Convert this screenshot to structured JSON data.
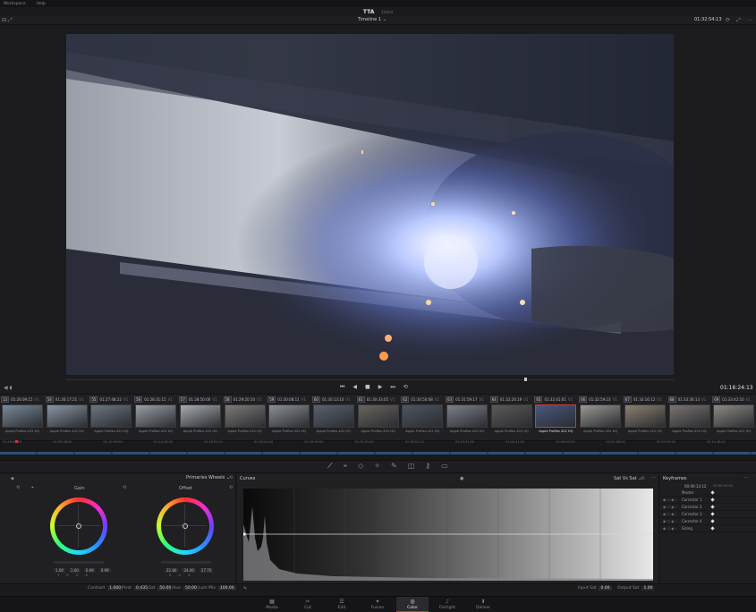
{
  "menu": {
    "items": [
      "Workspace",
      "Help"
    ]
  },
  "app": {
    "title": "TTA",
    "subtitle": "Edited"
  },
  "viewer": {
    "timeline_name": "Timeline 1",
    "timecode": "01:32:54:13"
  },
  "transport": {
    "timecode": "01:16:24:13"
  },
  "clips": [
    {
      "num": "13",
      "tc": "01:26:09:15",
      "track": "V1",
      "codec": "Apple ProRes 422 HQ",
      "color": "#7a8a98"
    },
    {
      "num": "54",
      "tc": "01:26:17:21",
      "track": "V1",
      "codec": "Apple ProRes 422 HQ",
      "color": "#8a96a4"
    },
    {
      "num": "55",
      "tc": "01:27:48:22",
      "track": "V1",
      "codec": "Apple ProRes 422 HQ",
      "color": "#6c7680"
    },
    {
      "num": "56",
      "tc": "01:28:31:15",
      "track": "V1",
      "codec": "Apple ProRes 422 HQ",
      "color": "#9aa0a6"
    },
    {
      "num": "57",
      "tc": "01:28:50:00",
      "track": "V1",
      "codec": "Apple ProRes 422 HQ",
      "color": "#a8acb0"
    },
    {
      "num": "58",
      "tc": "01:29:20:10",
      "track": "V1",
      "codec": "Apple ProRes 422 HQ",
      "color": "#7e7a76"
    },
    {
      "num": "59",
      "tc": "01:30:08:11",
      "track": "V1",
      "codec": "Apple ProRes 422 HQ",
      "color": "#8c9094"
    },
    {
      "num": "60",
      "tc": "01:30:13:10",
      "track": "V1",
      "codec": "Apple ProRes 422 HQ",
      "color": "#5a6270"
    },
    {
      "num": "61",
      "tc": "01:30:33:05",
      "track": "V1",
      "codec": "Apple ProRes 422 HQ",
      "color": "#6a645e"
    },
    {
      "num": "62",
      "tc": "01:30:50:08",
      "track": "V1",
      "codec": "Apple ProRes 422 HQ",
      "color": "#4e5662"
    },
    {
      "num": "63",
      "tc": "01:31:59:17",
      "track": "V1",
      "codec": "Apple ProRes 422 HQ",
      "color": "#7c8088"
    },
    {
      "num": "64",
      "tc": "01:32:26:19",
      "track": "V1",
      "codec": "Apple ProRes 422 HQ",
      "color": "#5c5a58"
    },
    {
      "num": "65",
      "tc": "01:32:41:01",
      "track": "V1",
      "codec": "Apple ProRes 422 HQ",
      "color": "#4a5880",
      "active": true
    },
    {
      "num": "66",
      "tc": "01:32:59:23",
      "track": "V1",
      "codec": "Apple ProRes 422 HQ",
      "color": "#9a9894"
    },
    {
      "num": "67",
      "tc": "01:33:16:12",
      "track": "V1",
      "codec": "Apple ProRes 422 HQ",
      "color": "#8a8070"
    },
    {
      "num": "68",
      "tc": "01:33:30:13",
      "track": "V1",
      "codec": "Apple ProRes 422 HQ",
      "color": "#7a7470"
    },
    {
      "num": "69",
      "tc": "01:33:42:10",
      "track": "V1",
      "codec": "Apple ProRes 422 HQ",
      "color": "#8e8a84"
    }
  ],
  "mini_timeline": {
    "ticks": [
      "01:00:00:00",
      "01:05:58:00",
      "01:10:09:00",
      "01:14:26:00",
      "01:18:59:12",
      "01:20:04:00",
      "01:29:00:00",
      "01:31:52:00",
      "01:38:52:12",
      "01:45:31:00",
      "01:49:41:00",
      "01:56:00:00",
      "02:00:58:00",
      "02:09:34:00",
      "02:14:48:12"
    ]
  },
  "wheels": {
    "panel_title": "Primaries Wheels",
    "gain": {
      "label": "Gain",
      "values": [
        "1.00",
        "1.00",
        "0.99",
        "0.99"
      ],
      "letters": [
        "Y",
        "R",
        "G",
        "B"
      ]
    },
    "offset": {
      "label": "Offset",
      "values": [
        "22.80",
        "24.00",
        "27.70"
      ],
      "letters": [
        "R",
        "G",
        "B"
      ]
    }
  },
  "curves": {
    "title": "Curves",
    "mode": "Sat Vs Sat"
  },
  "keyframes": {
    "title": "Keyframes",
    "timecode": "00:00:13:12",
    "timecode2": "00:00:00:00",
    "rows": [
      "Master",
      "Corrector 1",
      "Corrector 2",
      "Corrector 3",
      "Corrector 4",
      "Sizing"
    ]
  },
  "status": {
    "contrast_label": "Contrast",
    "contrast": "1.000",
    "pivot_label": "Pivot",
    "pivot": "0.435",
    "sat_label": "Sat",
    "sat": "50.00",
    "hue_label": "Hue",
    "hue": "50.00",
    "lummix_label": "Lum Mix",
    "lummix": "100.00",
    "input_sat_label": "Input Sat",
    "input_sat": "0.00",
    "output_sat_label": "Output Sat",
    "output_sat": "1.00"
  },
  "pages": [
    "Media",
    "Cut",
    "Edit",
    "Fusion",
    "Color",
    "Fairlight",
    "Deliver"
  ],
  "active_page": "Color"
}
